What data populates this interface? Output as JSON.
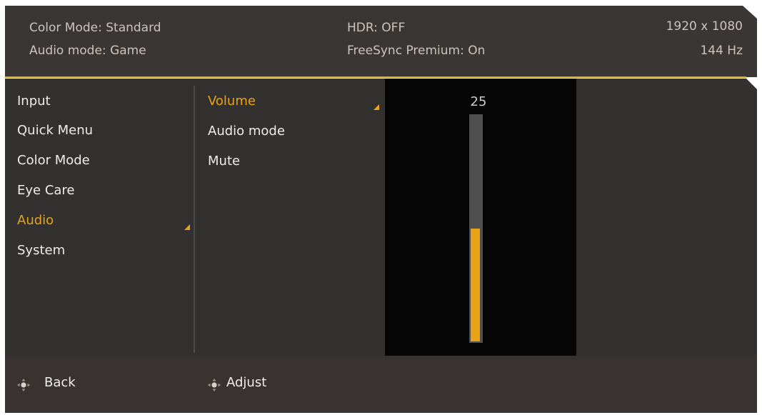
{
  "header": {
    "color_mode": "Color Mode: Standard",
    "audio_mode": "Audio mode: Game",
    "hdr": "HDR: OFF",
    "freesync": "FreeSync Premium: On",
    "resolution": "1920 x 1080",
    "refresh_rate": "144 Hz"
  },
  "main_menu": {
    "items": [
      {
        "label": "Input"
      },
      {
        "label": "Quick Menu"
      },
      {
        "label": "Color Mode"
      },
      {
        "label": "Eye Care"
      },
      {
        "label": "Audio",
        "active": true
      },
      {
        "label": "System"
      }
    ]
  },
  "sub_menu": {
    "items": [
      {
        "label": "Volume",
        "active": true
      },
      {
        "label": "Audio mode"
      },
      {
        "label": "Mute"
      }
    ]
  },
  "slider": {
    "value": "25",
    "level": 0.5
  },
  "footer": {
    "back_label": "Back",
    "adjust_label": "Adjust"
  },
  "colors": {
    "accent": "#e8a317",
    "header_bg": "#3a3634",
    "panel_bg": "#333130"
  }
}
